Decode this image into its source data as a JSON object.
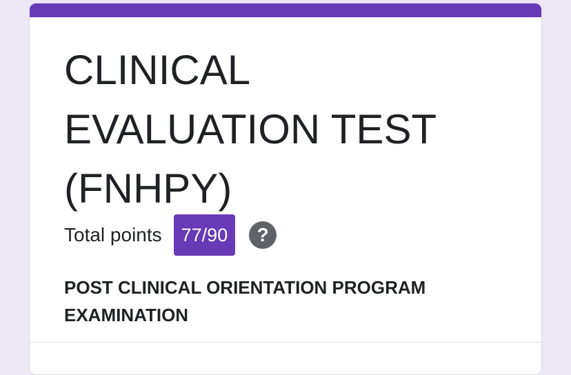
{
  "form": {
    "title": "CLINICAL EVALUATION TEST (FNHPY)",
    "total_points_label": "Total points",
    "score": "77/90",
    "help_icon_glyph": "?",
    "description": "POST CLINICAL ORIENTATION PROGRAM EXAMINATION",
    "accent_color": "#673ab7",
    "background_color": "#ede7f6"
  }
}
